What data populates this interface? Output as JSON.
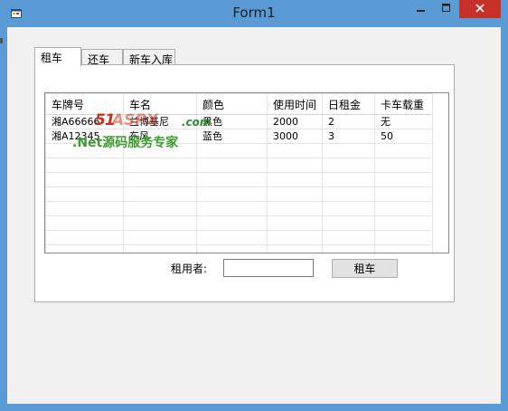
{
  "window": {
    "title": "Form1",
    "frame_color": "#5b9bd5",
    "close_color": "#c7312a"
  },
  "tabs": [
    {
      "label": "租车",
      "active": true
    },
    {
      "label": "还车",
      "active": false
    },
    {
      "label": "新车入库",
      "active": false
    }
  ],
  "grid": {
    "columns": [
      "车牌号",
      "车名",
      "颜色",
      "使用时间",
      "日租金",
      "卡车载重"
    ],
    "rows": [
      [
        "湘A66666",
        "兰博基尼",
        "黑色",
        "2000",
        "2",
        "无"
      ],
      [
        "湘A12345",
        "东风",
        "蓝色",
        "3000",
        "3",
        "50"
      ]
    ],
    "empty_rows": 8
  },
  "watermark": {
    "logo_left": "51",
    "logo_right": "ASPX",
    "logo_domain": ".com",
    "tagline": ".Net源码服务专家"
  },
  "form": {
    "renter_label": "租用者:",
    "renter_value": "",
    "rent_button": "租车"
  },
  "icons": {
    "app": "window-app-icon",
    "minimize": "minimize-icon",
    "maximize": "maximize-icon",
    "close": "close-icon"
  }
}
